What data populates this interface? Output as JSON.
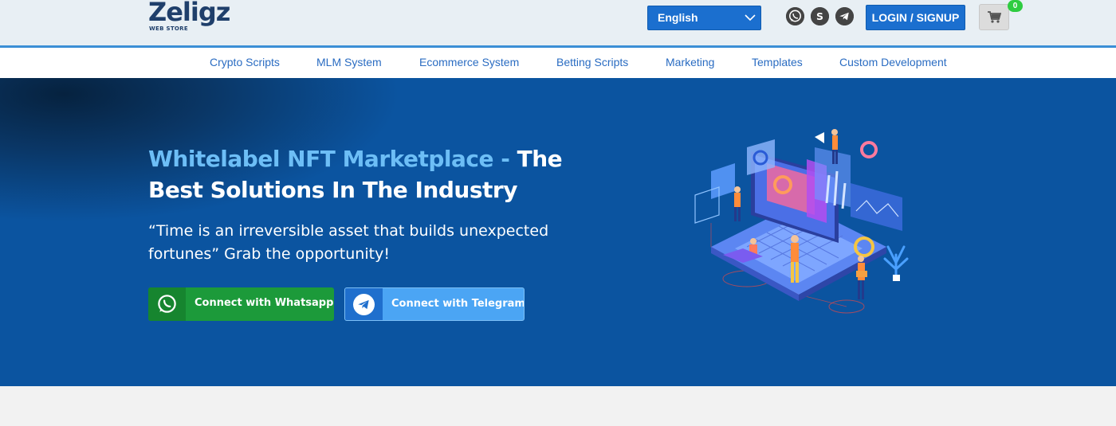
{
  "header": {
    "logo": {
      "name": "Zeligz",
      "subtitle": "WEB STORE"
    },
    "language": {
      "selected": "English"
    },
    "social_icons": [
      "whatsapp-icon",
      "skype-icon",
      "telegram-icon"
    ],
    "login_label": "LOGIN / SIGNUP",
    "cart": {
      "icon": "cart-icon",
      "count": "0"
    }
  },
  "nav": {
    "items": [
      {
        "label": "Crypto Scripts"
      },
      {
        "label": "MLM System"
      },
      {
        "label": "Ecommerce System"
      },
      {
        "label": "Betting Scripts"
      },
      {
        "label": "Marketing"
      },
      {
        "label": "Templates"
      },
      {
        "label": "Custom Development"
      }
    ]
  },
  "hero": {
    "title_accent": "Whitelabel NFT Marketplace -",
    "title_rest": "The Best Solutions In The Industry",
    "quote": "“Time is an irreversible asset that builds unexpected fortunes” Grab the opportunity!",
    "cta_whatsapp": "Connect with Whatsapp",
    "cta_telegram": "Connect with Telegram"
  },
  "colors": {
    "hero_bg": "#0b54a0",
    "accent": "#6dbef6",
    "primary": "#1b6fcf",
    "whatsapp": "#1c9a3a",
    "telegram": "#4ba5f4",
    "badge": "#2ecc40"
  }
}
